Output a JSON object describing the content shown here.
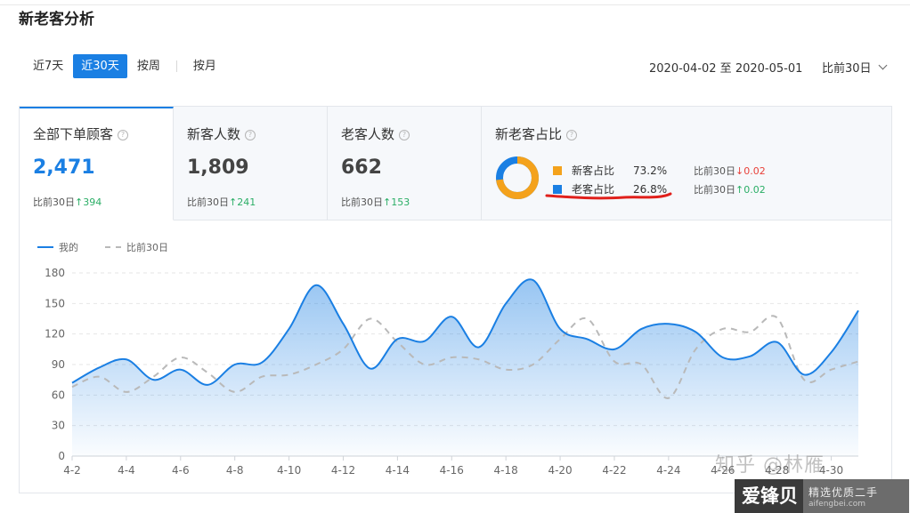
{
  "page": {
    "title": "新老客分析"
  },
  "tabs": [
    {
      "label": "近7天"
    },
    {
      "label": "近30天",
      "active": true
    },
    {
      "label": "按周"
    },
    {
      "label": "按月"
    }
  ],
  "date_range": "2020-04-02 至 2020-05-01",
  "compare_select": "比前30日",
  "cards": [
    {
      "title": "全部下单顾客",
      "value": "2,471",
      "cmp_label": "比前30日",
      "arrow": "↑",
      "cmp_value": "394"
    },
    {
      "title": "新客人数",
      "value": "1,809",
      "cmp_label": "比前30日",
      "arrow": "↑",
      "cmp_value": "241"
    },
    {
      "title": "老客人数",
      "value": "662",
      "cmp_label": "比前30日",
      "arrow": "↑",
      "cmp_value": "153"
    }
  ],
  "ratio": {
    "title": "新老客占比",
    "rows": [
      {
        "label": "新客占比",
        "value": "73.2%",
        "color": "#f4a21c",
        "cmp_label": "比前30日",
        "arrow": "↓",
        "cmp_value": "0.02"
      },
      {
        "label": "老客占比",
        "value": "26.8%",
        "color": "#1a7fe3",
        "cmp_label": "比前30日",
        "arrow": "↑",
        "cmp_value": "0.02"
      }
    ],
    "donut_fraction_new": 0.732
  },
  "colors": {
    "accent": "#1a7fe3",
    "compare": "#b9b9b9",
    "up": "#2bae66",
    "down": "#e8413a",
    "annotation": "#e0201b"
  },
  "icons": {
    "help": "question-circle-icon",
    "chevron": "chevron-down-icon"
  },
  "watermark": {
    "text": "知乎 @林雁"
  },
  "badge": {
    "left": "爱锋贝",
    "top": "精选优质二手",
    "bottom": "aifengbei.com"
  },
  "chart_data": {
    "type": "line",
    "legend": [
      "我的",
      "比前30日"
    ],
    "x": [
      "4-2",
      "4-3",
      "4-4",
      "4-5",
      "4-6",
      "4-7",
      "4-8",
      "4-9",
      "4-10",
      "4-11",
      "4-12",
      "4-13",
      "4-14",
      "4-15",
      "4-16",
      "4-17",
      "4-18",
      "4-19",
      "4-20",
      "4-21",
      "4-22",
      "4-23",
      "4-24",
      "4-25",
      "4-26",
      "4-27",
      "4-28",
      "4-29",
      "4-30",
      "5-1"
    ],
    "x_tick_labels": [
      "4-2",
      "4-4",
      "4-6",
      "4-8",
      "4-10",
      "4-12",
      "4-14",
      "4-16",
      "4-18",
      "4-20",
      "4-22",
      "4-24",
      "4-26",
      "4-28",
      "4-30"
    ],
    "series": [
      {
        "name": "我的",
        "values": [
          72,
          87,
          95,
          75,
          85,
          70,
          90,
          92,
          125,
          168,
          130,
          86,
          115,
          113,
          137,
          107,
          150,
          173,
          125,
          115,
          105,
          125,
          130,
          122,
          97,
          98,
          112,
          80,
          102,
          143
        ]
      },
      {
        "name": "比前30日",
        "values": [
          68,
          78,
          63,
          78,
          97,
          82,
          63,
          78,
          80,
          90,
          105,
          135,
          112,
          90,
          97,
          95,
          85,
          90,
          115,
          135,
          93,
          90,
          57,
          105,
          125,
          122,
          136,
          75,
          85,
          93
        ]
      }
    ],
    "yticks": [
      0,
      30,
      60,
      90,
      120,
      150,
      180
    ],
    "ylim": [
      0,
      180
    ],
    "grid": true,
    "legend_position": "top-left",
    "area_fill_first_series": true
  }
}
